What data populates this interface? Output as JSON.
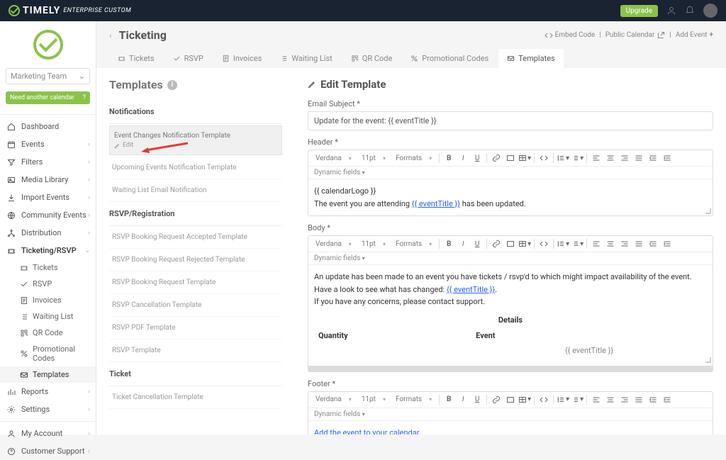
{
  "topbar": {
    "brand": "TIMELY",
    "brand_sub": "ENTERPRISE CUSTOM",
    "upgrade": "Upgrade"
  },
  "sidebar": {
    "team": "Marketing Team",
    "need_calendar": "Need another calendar",
    "items": [
      {
        "icon": "home",
        "label": "Dashboard",
        "chev": false
      },
      {
        "icon": "calendar",
        "label": "Events",
        "chev": true
      },
      {
        "icon": "filter",
        "label": "Filters",
        "chev": true
      },
      {
        "icon": "image",
        "label": "Media Library",
        "chev": true
      },
      {
        "icon": "download",
        "label": "Import Events",
        "chev": true
      },
      {
        "icon": "globe",
        "label": "Community Events",
        "chev": true
      },
      {
        "icon": "share",
        "label": "Distribution",
        "chev": true
      },
      {
        "icon": "ticket",
        "label": "Ticketing/RSVP",
        "chev": true,
        "active": true,
        "expanded": true,
        "subs": [
          {
            "icon": "ticket",
            "label": "Tickets"
          },
          {
            "icon": "check",
            "label": "RSVP"
          },
          {
            "icon": "invoice",
            "label": "Invoices"
          },
          {
            "icon": "list",
            "label": "Waiting List"
          },
          {
            "icon": "qr",
            "label": "QR Code"
          },
          {
            "icon": "percent",
            "label": "Promotional Codes"
          },
          {
            "icon": "mail",
            "label": "Templates",
            "active": true
          }
        ]
      },
      {
        "icon": "bars",
        "label": "Reports",
        "chev": true
      },
      {
        "icon": "gear",
        "label": "Settings",
        "chev": true
      }
    ],
    "footer": [
      {
        "icon": "user",
        "label": "My Account",
        "chev": true
      },
      {
        "icon": "help",
        "label": "Customer Support",
        "chev": true
      }
    ]
  },
  "header": {
    "title": "Ticketing",
    "links": {
      "embed": "Embed Code",
      "public": "Public Calendar",
      "add": "Add Event"
    }
  },
  "tabs": [
    {
      "icon": "ticket",
      "label": "Tickets"
    },
    {
      "icon": "check",
      "label": "RSVP"
    },
    {
      "icon": "invoice",
      "label": "Invoices"
    },
    {
      "icon": "list",
      "label": "Waiting List"
    },
    {
      "icon": "qr",
      "label": "QR Code"
    },
    {
      "icon": "percent",
      "label": "Promotional Codes"
    },
    {
      "icon": "mail",
      "label": "Templates",
      "active": true
    }
  ],
  "templates": {
    "title": "Templates",
    "sections": [
      {
        "head": "Notifications",
        "items": [
          {
            "label": "Event Changes Notification Template",
            "selected": true,
            "edit": "Edit"
          },
          {
            "label": "Upcoming Events Notification Template"
          },
          {
            "label": "Waiting List Email Notification"
          }
        ]
      },
      {
        "head": "RSVP/Registration",
        "items": [
          {
            "label": "RSVP Booking Request Accepted Template"
          },
          {
            "label": "RSVP Booking Request Rejected Template"
          },
          {
            "label": "RSVP Booking Request Template"
          },
          {
            "label": "RSVP Cancellation Template"
          },
          {
            "label": "RSVP PDF Template"
          },
          {
            "label": "RSVP Template"
          }
        ]
      },
      {
        "head": "Ticket",
        "items": [
          {
            "label": "Ticket Cancellation Template"
          }
        ]
      }
    ]
  },
  "edit": {
    "title": "Edit Template",
    "subject_label": "Email Subject *",
    "subject_value": "Update for the event: {{ eventTitle }}",
    "header_label": "Header *",
    "body_label": "Body *",
    "footer_label": "Footer *",
    "toolbar": {
      "font": "Verdana",
      "size": "11pt",
      "formats": "Formats",
      "dynamic": "Dynamic fields"
    },
    "header_body": {
      "line1": "{{ calendarLogo }}",
      "line2a": "The event you are attending ",
      "line2link": "{{ eventTitle }}",
      "line2b": " has been updated."
    },
    "body_body": {
      "p1": "An update has been made to an event you have tickets / rsvp'd to which might impact availability of the event.",
      "p2a": "Have a look to see what has changed: ",
      "p2link": "{{ eventTitle }}",
      "p2b": ".",
      "p3": "If you have any concerns, please contact support.",
      "details_head": "Details",
      "col1": "Quantity",
      "col2": "Event",
      "cell": "{{ eventTitle }}"
    },
    "footer_body": {
      "link": "Add the event to your calendar."
    }
  }
}
